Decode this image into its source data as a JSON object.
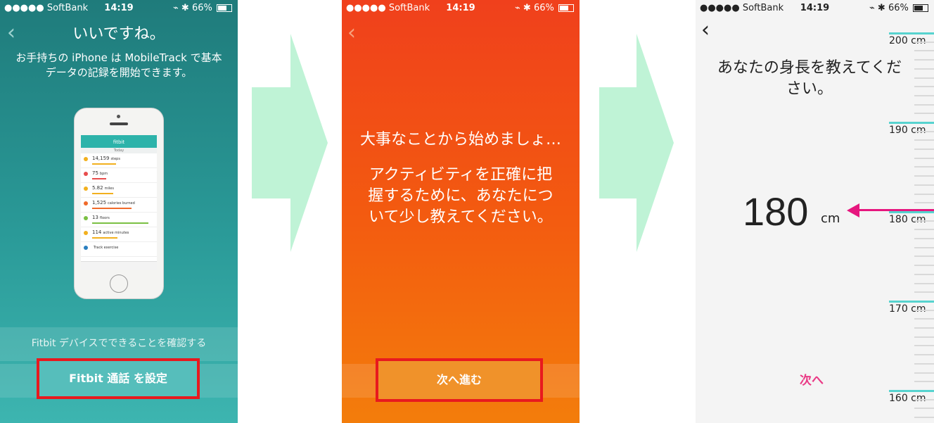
{
  "status": {
    "carrier": "●●●●● SoftBank",
    "time": "14:19",
    "battery": "66%",
    "icons": "⌁ ✱"
  },
  "screen1": {
    "title": "いいですね。",
    "subtitle": "お手持ちの iPhone は MobileTrack で基本データの記録を開始できます。",
    "secondary_link": "Fitbit デバイスでできることを確認する",
    "setup_button": "Fitbit 通話 を設定",
    "phone": {
      "app_title": "fitbit",
      "day": "Today",
      "rows": [
        {
          "value": "14,159",
          "unit": "steps",
          "color": "#f2b01e"
        },
        {
          "value": "75",
          "unit": "bpm",
          "color": "#e84c4c"
        },
        {
          "value": "5.82",
          "unit": "miles",
          "color": "#f2b01e"
        },
        {
          "value": "1,525",
          "unit": "calories burned",
          "color": "#f06a2a"
        },
        {
          "value": "13",
          "unit": "floors",
          "color": "#7bc043"
        },
        {
          "value": "114",
          "unit": "active minutes",
          "color": "#f2b01e"
        },
        {
          "value": "",
          "unit": "Track exercise",
          "color": "#2a7fbf"
        }
      ]
    }
  },
  "screen2": {
    "heading": "大事なことから始めましょ…",
    "body": "アクティビティを正確に把握するために、あなたについて少し教えてください。",
    "next_button": "次へ進む"
  },
  "screen3": {
    "question": "あなたの身長を教えてください。",
    "value": "180",
    "unit": "cm",
    "next_button": "次へ",
    "ruler": [
      "200 cm",
      "190 cm",
      "180 cm",
      "170 cm",
      "160 cm"
    ]
  },
  "colors": {
    "teal": "#2a9a98",
    "orange": "#f35a10",
    "pink": "#e6167e",
    "highlight": "#e8191e",
    "arrow": "#bff3d6"
  }
}
